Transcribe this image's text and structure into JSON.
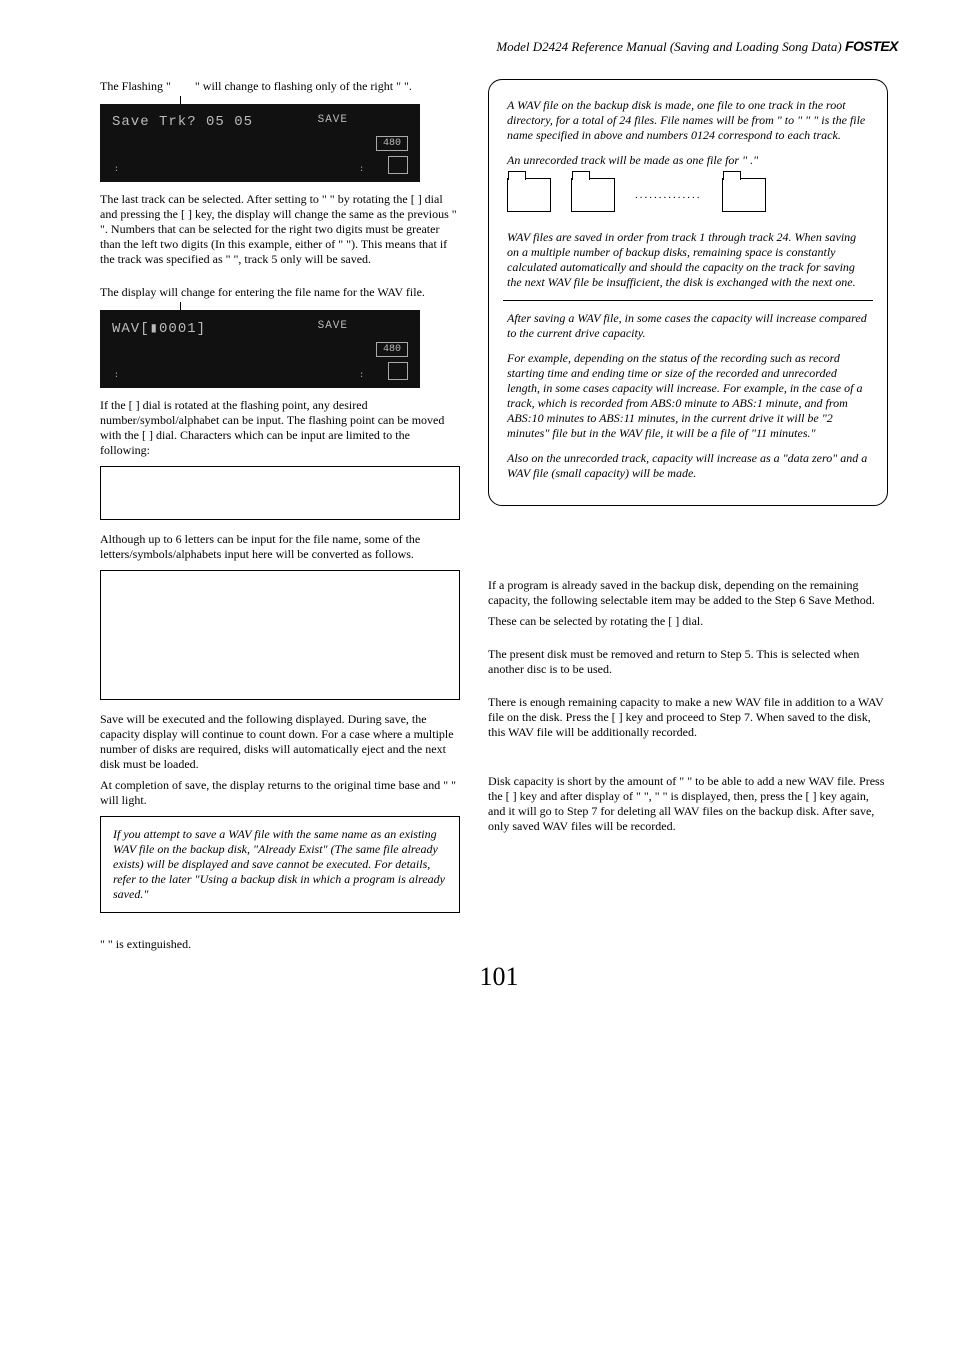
{
  "header": {
    "title": "Model D2424  Reference Manual (Saving and Loading Song Data)",
    "brand": "FOSTEX"
  },
  "left": {
    "p1a": "The Flashing \"",
    "p1b": "\" will change to flashing only of the right \"    \".",
    "lcd1": {
      "line1": "Save Trk? 05 05",
      "tag": "SAVE",
      "badge": "480"
    },
    "p2": "The last track can be selected.  After setting to \"        \" by rotating the [        ] dial and pressing the [        ] key, the display will change the same as the previous \"                              \".  Numbers that can be selected for the right two digits must be greater than the left two digits (In this example, either of \"          \"). This means that if the track was specified as \"          \", track 5 only will be saved.",
    "p3": "The display will change for entering the file name for the WAV file.",
    "lcd2": {
      "line1": "WAV[▮0001]",
      "tag": "SAVE",
      "badge": "480"
    },
    "p4": "If the [        ] dial is rotated at the flashing point, any desired number/symbol/alphabet can be input.  The flashing point can be moved with the [               ] dial. Characters which can be input are limited to the following:",
    "p5": "Although up to 6 letters can be input for the file name, some of the letters/symbols/alphabets input here will be converted as follows.",
    "p6": "Save will be executed and the following displayed.  During save, the capacity display will continue to count down.  For a case where a multiple number of disks are required, disks will automatically eject and the next disk must be loaded.",
    "p7": "At completion of save, the display returns to the original time base and \"                       \" will light.",
    "warn": "If you attempt to save a WAV file with the same name as an existing WAV file on the backup disk, \"Already Exist\" (The same file already exists) will be displayed and save cannot be executed.  For details, refer to the later \"Using a backup disk in which a program is already saved.\"",
    "p8": "\"                       \" is extinguished."
  },
  "right": {
    "n1": "A WAV file on the backup disk is made, one file to one track in the root directory, for a total of 24 files.  File names will be from \"                       to \"                       \"        \" is the file name specified in above and numbers 0124 correspond to each track.",
    "n2": "An unrecorded track will be made as one file for \"              .\"",
    "n3": " WAV files are saved in order from track 1 through track 24.  When saving on a multiple number of backup disks, remaining space is constantly calculated automatically and should the capacity on the track for saving the next WAV file be insufficient, the disk is exchanged with the next one.",
    "n4": "After saving a WAV file, in some cases the capacity will increase compared to the current drive capacity.",
    "n5": "For example, depending on the status of the recording such as record starting time and ending time or size of the recorded and unrecorded length, in some cases capacity will increase.  For example, in the case of a track, which is recorded from ABS:0 minute to ABS:1 minute, and from ABS:10 minutes to ABS:11 minutes, in the current drive it will be \"2 minutes\" file but in the WAV file, it will be a file of \"11 minutes.\"",
    "n6": "Also on the unrecorded track, capacity will increase as a \"data zero\" and a WAV file (small capacity) will be made.",
    "p9": "If a program is already saved in the backup disk, depending on the remaining capacity, the following selectable item may be added to the Step 6 Save Method.",
    "p10": "These can be selected by rotating the [        ] dial.",
    "p11": "The present disk must be removed and return to Step 5. This is selected when another disc is to be used.",
    "p12": "There is enough remaining capacity to make a new WAV file in addition to a WAV file on the disk.  Press the [                 ] key and proceed to Step 7.  When saved to the disk, this WAV file will be additionally recorded.",
    "p13": "Disk capacity is short by the amount of \"        \" to be able to add a new WAV file.  Press the [                      ] key and after display of \"              \", \"                        \" is displayed, then, press the [                      ] key again, and it will go to Step 7 for deleting all WAV files on the backup disk.  After save, only saved WAV files will be recorded."
  },
  "pagenum": "101"
}
